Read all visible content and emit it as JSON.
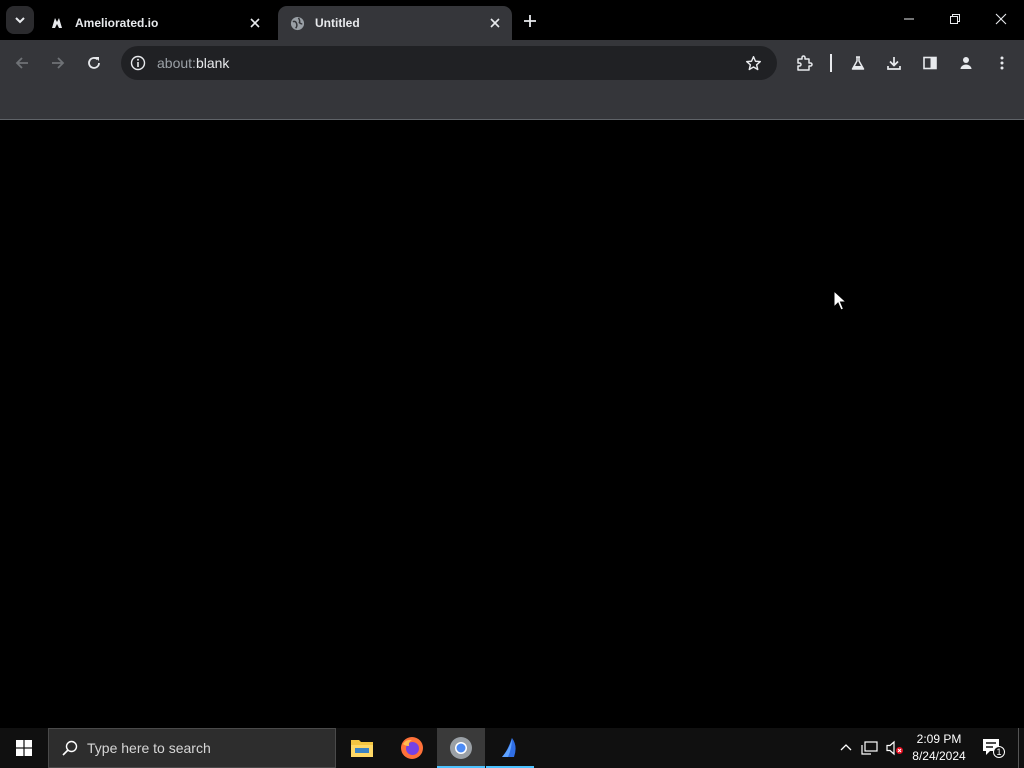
{
  "browser": {
    "tabs": [
      {
        "title": "Ameliorated.io",
        "favicon": "ameliorated-icon",
        "active": false
      },
      {
        "title": "Untitled",
        "favicon": "globe-icon",
        "active": true
      }
    ],
    "omnibox": {
      "scheme": "about:",
      "path": "blank"
    }
  },
  "taskbar": {
    "search_placeholder": "Type here to search",
    "apps": [
      "file-explorer-icon",
      "firefox-icon",
      "chrome-icon",
      "app-icon"
    ],
    "clock": {
      "time": "2:09 PM",
      "date": "8/24/2024"
    },
    "notification_count": "1"
  },
  "colors": {
    "tab_strip": "#000000",
    "toolbar": "#35363a",
    "omnibox": "#202124",
    "content": "#000000",
    "taskbar": "#101010",
    "chrome_accent": "#4cc2ff",
    "firefox_accent": "#ff7139"
  }
}
